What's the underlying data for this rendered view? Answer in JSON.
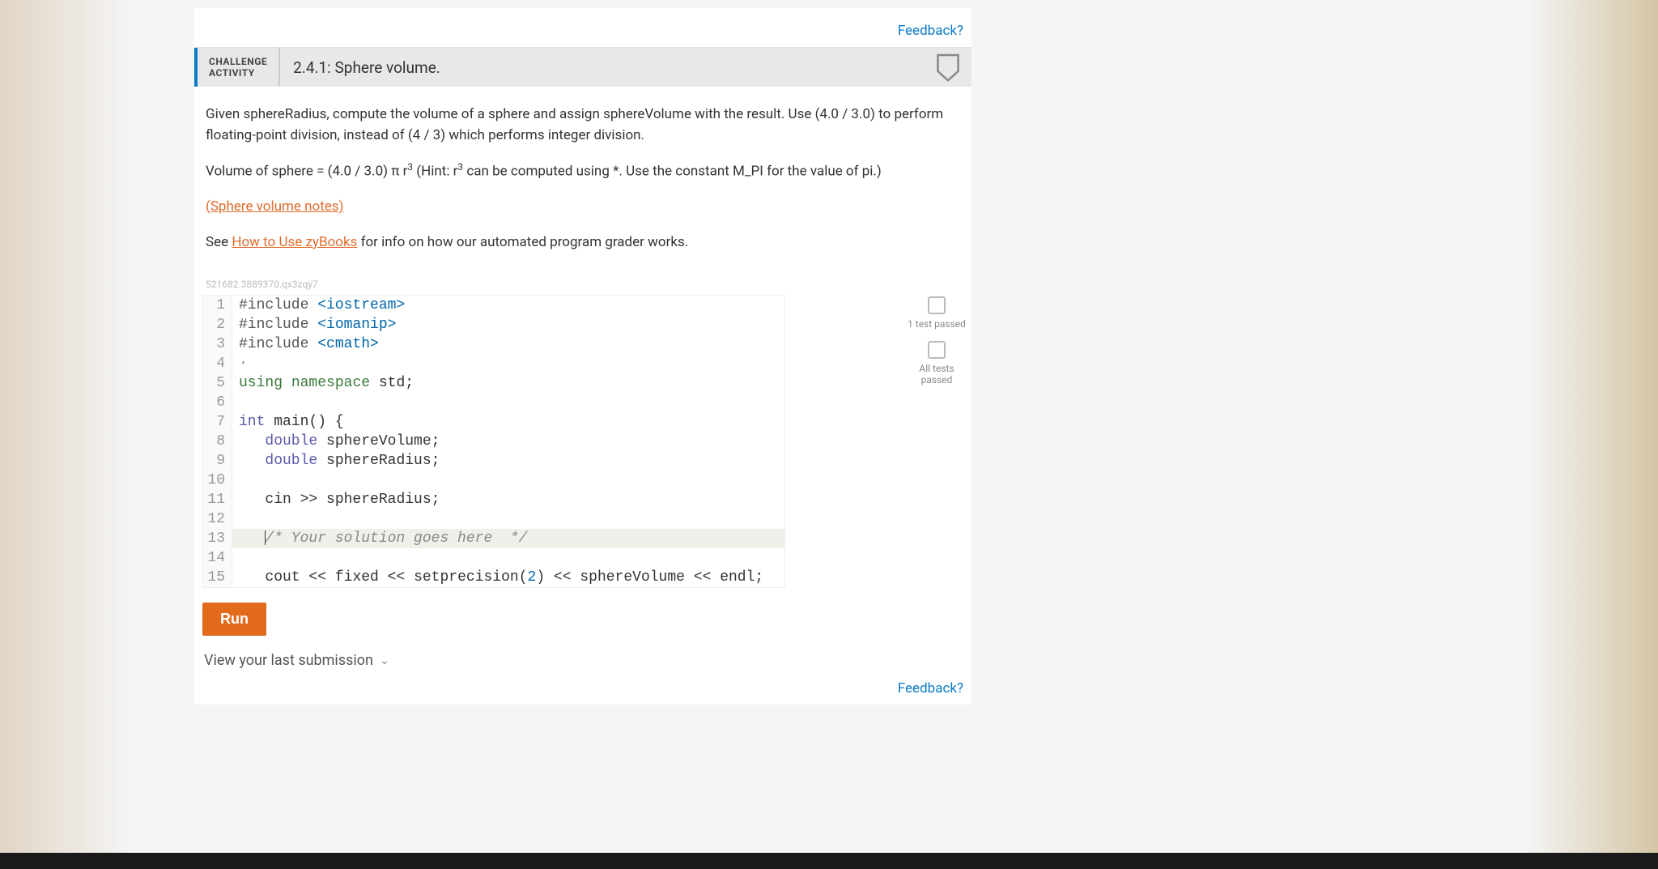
{
  "feedback_label": "Feedback?",
  "activity": {
    "tag_line1": "CHALLENGE",
    "tag_line2": "ACTIVITY",
    "title": "2.4.1: Sphere volume."
  },
  "instructions": {
    "p1": "Given sphereRadius, compute the volume of a sphere and assign sphereVolume with the result. Use (4.0 / 3.0) to perform floating-point division, instead of (4 / 3) which performs integer division.",
    "p2_prefix": "Volume of sphere = (4.0 / 3.0) π r",
    "p2_sup1": "3",
    "p2_mid": " (Hint: r",
    "p2_sup2": "3",
    "p2_suffix": " can be computed using *. Use the constant M_PI for the value of pi.)",
    "notes_link": "(Sphere volume notes)",
    "see_prefix": "See ",
    "howto_link": "How to Use zyBooks",
    "see_suffix": " for info on how our automated program grader works."
  },
  "hash": "521682.3889370.qx3zqy7",
  "code_lines": [
    {
      "n": "1",
      "hl": false,
      "html": "<span class='pp'>#include</span> <span class='st'>&lt;iostream&gt;</span>"
    },
    {
      "n": "2",
      "hl": false,
      "html": "<span class='pp'>#include</span> <span class='st'>&lt;iomanip&gt;</span>"
    },
    {
      "n": "3",
      "hl": false,
      "html": "<span class='pp'>#include</span> <span class='st'>&lt;cmath&gt;</span>"
    },
    {
      "n": "4",
      "hl": false,
      "html": "<span class='cm'>·</span>"
    },
    {
      "n": "5",
      "hl": false,
      "html": "<span class='kw'>using</span> <span class='kw'>namespace</span> <span class='id'>std</span>;"
    },
    {
      "n": "6",
      "hl": false,
      "html": ""
    },
    {
      "n": "7",
      "hl": false,
      "html": "<span class='ty'>int</span> <span class='fn'>main</span>() {"
    },
    {
      "n": "8",
      "hl": false,
      "html": "   <span class='ty'>double</span> <span class='id'>sphereVolume</span>;"
    },
    {
      "n": "9",
      "hl": false,
      "html": "   <span class='ty'>double</span> <span class='id'>sphereRadius</span>;"
    },
    {
      "n": "10",
      "hl": false,
      "html": ""
    },
    {
      "n": "11",
      "hl": false,
      "html": "   <span class='id'>cin</span> &gt;&gt; <span class='id'>sphereRadius</span>;"
    },
    {
      "n": "12",
      "hl": false,
      "html": ""
    },
    {
      "n": "13",
      "hl": true,
      "html": "   <span class='cursor-caret'></span><span class='cm'>/* Your solution goes here  */</span>"
    },
    {
      "n": "14",
      "hl": false,
      "html": ""
    },
    {
      "n": "15",
      "hl": false,
      "html": "   <span class='id'>cout</span> &lt;&lt; <span class='id'>fixed</span> &lt;&lt; <span class='fn'>setprecision</span>(<span class='st'>2</span>) &lt;&lt; <span class='id'>sphereVolume</span> &lt;&lt; <span class='id'>endl</span>;"
    }
  ],
  "status": {
    "test1": "1 test passed",
    "all": "All tests passed"
  },
  "run_label": "Run",
  "last_submission": "View your last submission"
}
